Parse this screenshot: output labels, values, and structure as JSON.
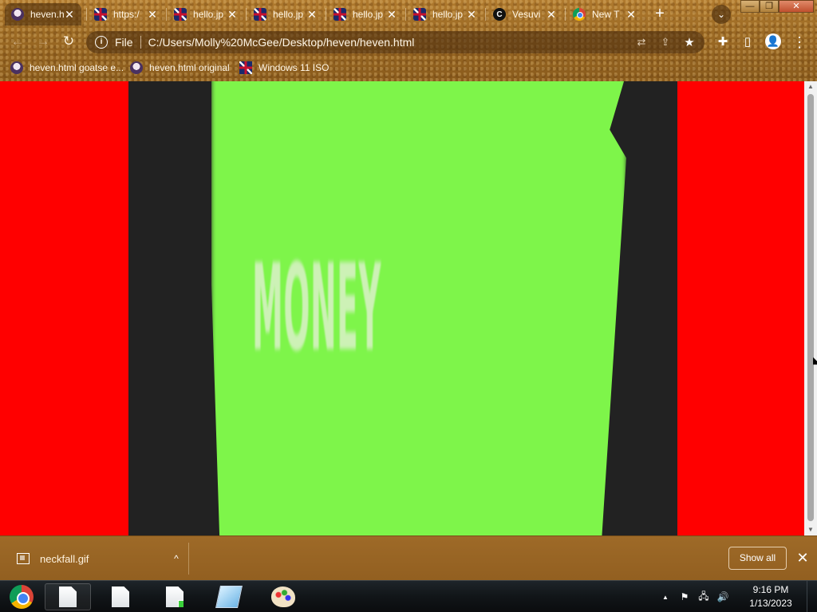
{
  "browser": {
    "tabs": [
      {
        "title": "heven.h",
        "favicon": "anime",
        "active": true
      },
      {
        "title": "https:/",
        "favicon": "uk-flag",
        "active": false
      },
      {
        "title": "hello.jp",
        "favicon": "uk-flag",
        "active": false
      },
      {
        "title": "hello.jp",
        "favicon": "uk-flag",
        "active": false
      },
      {
        "title": "hello.jp",
        "favicon": "uk-flag",
        "active": false
      },
      {
        "title": "hello.jp",
        "favicon": "uk-flag",
        "active": false
      },
      {
        "title": "Vesuvi",
        "favicon": "vesuvi",
        "active": false
      },
      {
        "title": "New T",
        "favicon": "chrome",
        "active": false
      }
    ],
    "tab_close_glyph": "✕",
    "new_tab_glyph": "+",
    "tab_search_glyph": "⌄",
    "window_controls": {
      "minimize": "—",
      "restore": "❐",
      "close": "✕"
    },
    "omnibox": {
      "scheme_label": "File",
      "url": "C:/Users/Molly%20McGee/Desktop/heven/heven.html",
      "info_glyph": "i"
    },
    "nav": {
      "back": "←",
      "forward": "→",
      "reload": "↻"
    },
    "toolbar_icons": {
      "translate": "⇄",
      "share": "⇪",
      "bookmark_star": "★",
      "extensions": "✚",
      "side_panel": "▯",
      "profile": "👤",
      "menu": "⋮"
    },
    "bookmarks": [
      {
        "label": "heven.html goatse e...",
        "favicon": "anime"
      },
      {
        "label": "heven.html original",
        "favicon": "anime"
      },
      {
        "label": "Windows 11 ISO",
        "favicon": "uk-flag"
      }
    ]
  },
  "page": {
    "background_color": "#ff0000",
    "video_text": "MONEY"
  },
  "scrollbar": {
    "up": "▲",
    "down": "▼"
  },
  "download_shelf": {
    "file_name": "neckfall.gif",
    "caret": "^",
    "show_all_label": "Show all",
    "close_glyph": "✕"
  },
  "taskbar": {
    "clock_time": "9:16 PM",
    "clock_date": "1/13/2023",
    "tray_icons": {
      "show_hidden": "▲",
      "action_center": "⚑",
      "network": "🖧",
      "volume": "🔊"
    }
  }
}
